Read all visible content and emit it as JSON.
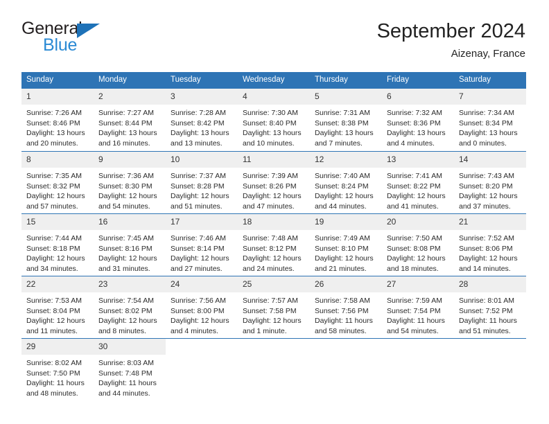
{
  "brand": {
    "name_line1": "General",
    "name_line2": "Blue",
    "logo_icon": "triangle-logo-icon",
    "color_dark": "#231f20",
    "color_blue": "#2b8ad4"
  },
  "header": {
    "title": "September 2024",
    "location": "Aizenay, France"
  },
  "theme": {
    "header_blue": "#2e74b5",
    "daynum_band": "#efefef",
    "text": "#222222"
  },
  "weekdays": [
    "Sunday",
    "Monday",
    "Tuesday",
    "Wednesday",
    "Thursday",
    "Friday",
    "Saturday"
  ],
  "weeks": [
    [
      {
        "day": "1",
        "sunrise": "Sunrise: 7:26 AM",
        "sunset": "Sunset: 8:46 PM",
        "daylight1": "Daylight: 13 hours",
        "daylight2": "and 20 minutes."
      },
      {
        "day": "2",
        "sunrise": "Sunrise: 7:27 AM",
        "sunset": "Sunset: 8:44 PM",
        "daylight1": "Daylight: 13 hours",
        "daylight2": "and 16 minutes."
      },
      {
        "day": "3",
        "sunrise": "Sunrise: 7:28 AM",
        "sunset": "Sunset: 8:42 PM",
        "daylight1": "Daylight: 13 hours",
        "daylight2": "and 13 minutes."
      },
      {
        "day": "4",
        "sunrise": "Sunrise: 7:30 AM",
        "sunset": "Sunset: 8:40 PM",
        "daylight1": "Daylight: 13 hours",
        "daylight2": "and 10 minutes."
      },
      {
        "day": "5",
        "sunrise": "Sunrise: 7:31 AM",
        "sunset": "Sunset: 8:38 PM",
        "daylight1": "Daylight: 13 hours",
        "daylight2": "and 7 minutes."
      },
      {
        "day": "6",
        "sunrise": "Sunrise: 7:32 AM",
        "sunset": "Sunset: 8:36 PM",
        "daylight1": "Daylight: 13 hours",
        "daylight2": "and 4 minutes."
      },
      {
        "day": "7",
        "sunrise": "Sunrise: 7:34 AM",
        "sunset": "Sunset: 8:34 PM",
        "daylight1": "Daylight: 13 hours",
        "daylight2": "and 0 minutes."
      }
    ],
    [
      {
        "day": "8",
        "sunrise": "Sunrise: 7:35 AM",
        "sunset": "Sunset: 8:32 PM",
        "daylight1": "Daylight: 12 hours",
        "daylight2": "and 57 minutes."
      },
      {
        "day": "9",
        "sunrise": "Sunrise: 7:36 AM",
        "sunset": "Sunset: 8:30 PM",
        "daylight1": "Daylight: 12 hours",
        "daylight2": "and 54 minutes."
      },
      {
        "day": "10",
        "sunrise": "Sunrise: 7:37 AM",
        "sunset": "Sunset: 8:28 PM",
        "daylight1": "Daylight: 12 hours",
        "daylight2": "and 51 minutes."
      },
      {
        "day": "11",
        "sunrise": "Sunrise: 7:39 AM",
        "sunset": "Sunset: 8:26 PM",
        "daylight1": "Daylight: 12 hours",
        "daylight2": "and 47 minutes."
      },
      {
        "day": "12",
        "sunrise": "Sunrise: 7:40 AM",
        "sunset": "Sunset: 8:24 PM",
        "daylight1": "Daylight: 12 hours",
        "daylight2": "and 44 minutes."
      },
      {
        "day": "13",
        "sunrise": "Sunrise: 7:41 AM",
        "sunset": "Sunset: 8:22 PM",
        "daylight1": "Daylight: 12 hours",
        "daylight2": "and 41 minutes."
      },
      {
        "day": "14",
        "sunrise": "Sunrise: 7:43 AM",
        "sunset": "Sunset: 8:20 PM",
        "daylight1": "Daylight: 12 hours",
        "daylight2": "and 37 minutes."
      }
    ],
    [
      {
        "day": "15",
        "sunrise": "Sunrise: 7:44 AM",
        "sunset": "Sunset: 8:18 PM",
        "daylight1": "Daylight: 12 hours",
        "daylight2": "and 34 minutes."
      },
      {
        "day": "16",
        "sunrise": "Sunrise: 7:45 AM",
        "sunset": "Sunset: 8:16 PM",
        "daylight1": "Daylight: 12 hours",
        "daylight2": "and 31 minutes."
      },
      {
        "day": "17",
        "sunrise": "Sunrise: 7:46 AM",
        "sunset": "Sunset: 8:14 PM",
        "daylight1": "Daylight: 12 hours",
        "daylight2": "and 27 minutes."
      },
      {
        "day": "18",
        "sunrise": "Sunrise: 7:48 AM",
        "sunset": "Sunset: 8:12 PM",
        "daylight1": "Daylight: 12 hours",
        "daylight2": "and 24 minutes."
      },
      {
        "day": "19",
        "sunrise": "Sunrise: 7:49 AM",
        "sunset": "Sunset: 8:10 PM",
        "daylight1": "Daylight: 12 hours",
        "daylight2": "and 21 minutes."
      },
      {
        "day": "20",
        "sunrise": "Sunrise: 7:50 AM",
        "sunset": "Sunset: 8:08 PM",
        "daylight1": "Daylight: 12 hours",
        "daylight2": "and 18 minutes."
      },
      {
        "day": "21",
        "sunrise": "Sunrise: 7:52 AM",
        "sunset": "Sunset: 8:06 PM",
        "daylight1": "Daylight: 12 hours",
        "daylight2": "and 14 minutes."
      }
    ],
    [
      {
        "day": "22",
        "sunrise": "Sunrise: 7:53 AM",
        "sunset": "Sunset: 8:04 PM",
        "daylight1": "Daylight: 12 hours",
        "daylight2": "and 11 minutes."
      },
      {
        "day": "23",
        "sunrise": "Sunrise: 7:54 AM",
        "sunset": "Sunset: 8:02 PM",
        "daylight1": "Daylight: 12 hours",
        "daylight2": "and 8 minutes."
      },
      {
        "day": "24",
        "sunrise": "Sunrise: 7:56 AM",
        "sunset": "Sunset: 8:00 PM",
        "daylight1": "Daylight: 12 hours",
        "daylight2": "and 4 minutes."
      },
      {
        "day": "25",
        "sunrise": "Sunrise: 7:57 AM",
        "sunset": "Sunset: 7:58 PM",
        "daylight1": "Daylight: 12 hours",
        "daylight2": "and 1 minute."
      },
      {
        "day": "26",
        "sunrise": "Sunrise: 7:58 AM",
        "sunset": "Sunset: 7:56 PM",
        "daylight1": "Daylight: 11 hours",
        "daylight2": "and 58 minutes."
      },
      {
        "day": "27",
        "sunrise": "Sunrise: 7:59 AM",
        "sunset": "Sunset: 7:54 PM",
        "daylight1": "Daylight: 11 hours",
        "daylight2": "and 54 minutes."
      },
      {
        "day": "28",
        "sunrise": "Sunrise: 8:01 AM",
        "sunset": "Sunset: 7:52 PM",
        "daylight1": "Daylight: 11 hours",
        "daylight2": "and 51 minutes."
      }
    ],
    [
      {
        "day": "29",
        "sunrise": "Sunrise: 8:02 AM",
        "sunset": "Sunset: 7:50 PM",
        "daylight1": "Daylight: 11 hours",
        "daylight2": "and 48 minutes."
      },
      {
        "day": "30",
        "sunrise": "Sunrise: 8:03 AM",
        "sunset": "Sunset: 7:48 PM",
        "daylight1": "Daylight: 11 hours",
        "daylight2": "and 44 minutes."
      },
      {
        "day": "",
        "sunrise": "",
        "sunset": "",
        "daylight1": "",
        "daylight2": ""
      },
      {
        "day": "",
        "sunrise": "",
        "sunset": "",
        "daylight1": "",
        "daylight2": ""
      },
      {
        "day": "",
        "sunrise": "",
        "sunset": "",
        "daylight1": "",
        "daylight2": ""
      },
      {
        "day": "",
        "sunrise": "",
        "sunset": "",
        "daylight1": "",
        "daylight2": ""
      },
      {
        "day": "",
        "sunrise": "",
        "sunset": "",
        "daylight1": "",
        "daylight2": ""
      }
    ]
  ]
}
